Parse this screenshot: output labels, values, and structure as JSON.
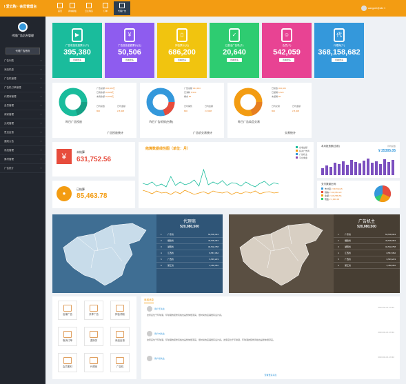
{
  "brand": "I 爱云购 · 会员管理台",
  "nav": [
    {
      "label": "首页"
    },
    {
      "label": "商城模板"
    },
    {
      "label": "云主购买"
    },
    {
      "label": "订单"
    },
    {
      "label": "代理广告"
    }
  ],
  "user": "wangwei@site",
  "sidebar": {
    "title": "代理广告后台管理",
    "home": "代理广告首页",
    "items": [
      "广告列表",
      "添加机型",
      "广告机管理",
      "广告机订单管理",
      "代理商管理",
      "会员管理",
      "商家管理",
      "分成管理",
      "意见反馈",
      "通知公告",
      "系统管理",
      "素材管理",
      "广告统计"
    ]
  },
  "cards": [
    {
      "label": "广告机投放量累计(个)",
      "value": "395,380",
      "btn": "查看更多",
      "color": "#1abc9c",
      "icon": "▶"
    },
    {
      "label": "广告投放金额累计(元)",
      "value": "50,506",
      "btn": "查看更多",
      "color": "#8e5cef",
      "icon": "¥"
    },
    {
      "label": "押金累计(元)",
      "value": "686,200",
      "btn": "查看更多",
      "color": "#f1c40f",
      "icon": "▯"
    },
    {
      "label": "已激活广告机(个)",
      "value": "20,640",
      "btn": "查看更多",
      "color": "#2ecc71",
      "icon": "✓"
    },
    {
      "label": "会员(个)",
      "value": "542,059",
      "btn": "查看更多",
      "color": "#e84393",
      "icon": "☺"
    },
    {
      "label": "代理商(个)",
      "value": "368,158,682",
      "btn": "查看更多",
      "color": "#3498db",
      "icon": "代"
    }
  ],
  "donuts": [
    {
      "title": "昨日广告投放",
      "total_l": "日均投放",
      "total_v": "800",
      "amt_l": "日均金额",
      "amt_v": "¥ 8,008",
      "c1": "#1abc9c",
      "c2": "#16a085",
      "legend": [
        "广告总额",
        "已用余额",
        "未用余额"
      ],
      "lv": [
        "324,324元",
        "34,929元",
        "34,929元"
      ]
    },
    {
      "title": "昨日广告机销(台数)",
      "total_l": "日均销售",
      "total_v": "800",
      "amt_l": "日均金额",
      "amt_v": "¥ 8,008",
      "c1": "#3498db",
      "c2": "#e74c3c",
      "legend": [
        "广告总额",
        "已消耗",
        "剩余"
      ],
      "lv": [
        "324,324",
        "5,520",
        "56"
      ]
    },
    {
      "title": "昨日广告商品交易",
      "total_l": "日均交易",
      "total_v": "800",
      "amt_l": "日均金额",
      "amt_v": "¥ 8,008",
      "c1": "#f39c12",
      "c2": "#e67e22",
      "legend": [
        "已投放",
        "已返佣",
        "未返佣"
      ],
      "lv": [
        "324,324",
        "5,520",
        "56"
      ]
    }
  ],
  "second_titles": [
    "广告投放统计",
    "广告机交易统计",
    "交易统计"
  ],
  "unsettled": {
    "label": "未结算",
    "value": "631,752.56"
  },
  "settled": {
    "label": "已结算",
    "value": "85,463.78"
  },
  "line": {
    "title": "结算数据线性图（单位：月）",
    "legend": [
      "总收益额",
      "投资广告商",
      "广告机主",
      "平台佣金"
    ]
  },
  "monthly": {
    "title": "本月投放额(当前)",
    "sub": "月均投放",
    "value": "¥ 25305.05"
  },
  "pie": {
    "title": "支付渠道比例:",
    "items": [
      {
        "l": "支付宝",
        "v": "¥ 98,763.25"
      },
      {
        "l": "微信",
        "v": "¥ 132,661.23"
      },
      {
        "l": "余额",
        "v": "¥ 236,589.56"
      },
      {
        "l": "现金",
        "v": "¥ 1,000.00"
      }
    ]
  },
  "map1": {
    "title": "代理商",
    "sum": "520,080,500",
    "rows": [
      [
        "1",
        "广东省",
        "53,545,324"
      ],
      [
        "2",
        "福建省",
        "43,545,363"
      ],
      [
        "3",
        "湖南省",
        "34,542,758"
      ],
      [
        "4",
        "江西省",
        "8,567,352"
      ],
      [
        "5",
        "广西省",
        "6,545,223"
      ],
      [
        "6",
        "浙江省",
        "2,456,352"
      ]
    ]
  },
  "map2": {
    "title": "广告机主",
    "sum": "520,080,500",
    "rows": [
      [
        "1",
        "广东省",
        "53,545,324"
      ],
      [
        "2",
        "福建省",
        "43,545,363"
      ],
      [
        "3",
        "湖南省",
        "34,542,758"
      ],
      [
        "4",
        "江西省",
        "8,567,352"
      ],
      [
        "5",
        "广西省",
        "6,545,223"
      ],
      [
        "6",
        "浙江省",
        "2,456,352"
      ]
    ]
  },
  "icons": [
    {
      "label": "店铺广告"
    },
    {
      "label": "共享广告"
    },
    {
      "label": "押金领取"
    },
    {
      "label": "取消订单"
    },
    {
      "label": "退换货"
    },
    {
      "label": "商品反馈"
    },
    {
      "label": "会员素材"
    },
    {
      "label": "代理商"
    },
    {
      "label": "广告机"
    }
  ],
  "messages": {
    "tab": "商城消息",
    "items": [
      {
        "who": "用户王先生",
        "date": "2016-02-01 19:32",
        "text": "这家店位于环球港，环球港的装修风格也是整体很漂亮，很时尚的店铺很有设计感。"
      },
      {
        "who": "用户刘先生",
        "date": "2016-02-01 19:32",
        "text": "这家店位于环球港，环球港的装修风格也是整体很漂亮，很时尚的店铺很有设计感。这家店位于环球港，环球港的装修风格也是整体很漂亮。"
      },
      {
        "who": "用户张先生",
        "date": "2016-02-01 19:32",
        "text": ""
      }
    ],
    "more": "查看更多消息"
  }
}
